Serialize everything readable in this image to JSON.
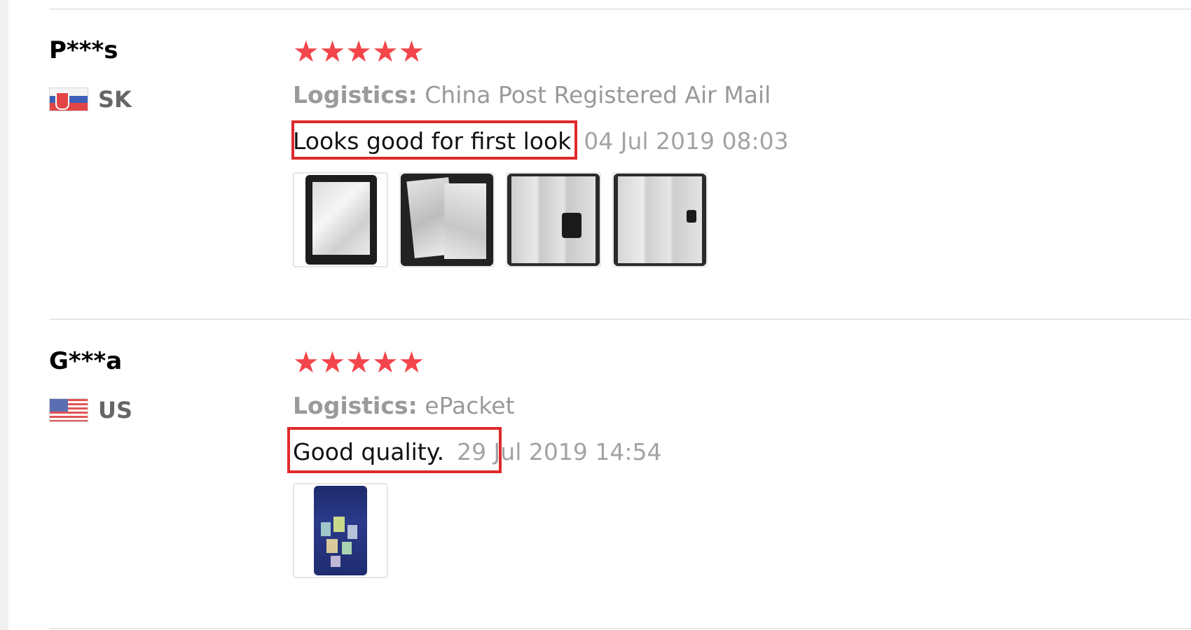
{
  "reviews": [
    {
      "user": "P***s",
      "country": "SK",
      "rating": 5,
      "stars": "★★★★★",
      "logistics_label": "Logistics:",
      "logistics_value": "China Post Registered Air Mail",
      "feedback": "Looks good for first look",
      "date": "04 Jul 2019 08:03",
      "images": [
        "photo of folded plastic sleeve sheet",
        "photo of sleeve pages",
        "photo of open pages",
        "photo of open pages"
      ]
    },
    {
      "user": "G***a",
      "country": "US",
      "rating": 5,
      "stars": "★★★★★",
      "logistics_label": "Logistics:",
      "logistics_value": "ePacket",
      "feedback": "Good quality.",
      "date": "29 Jul 2019 14:54",
      "images": [
        "photo of cards on dark background"
      ]
    }
  ],
  "colors": {
    "star": "#f2464b",
    "highlight_box": "#e02a2a",
    "muted_text": "#999999"
  }
}
